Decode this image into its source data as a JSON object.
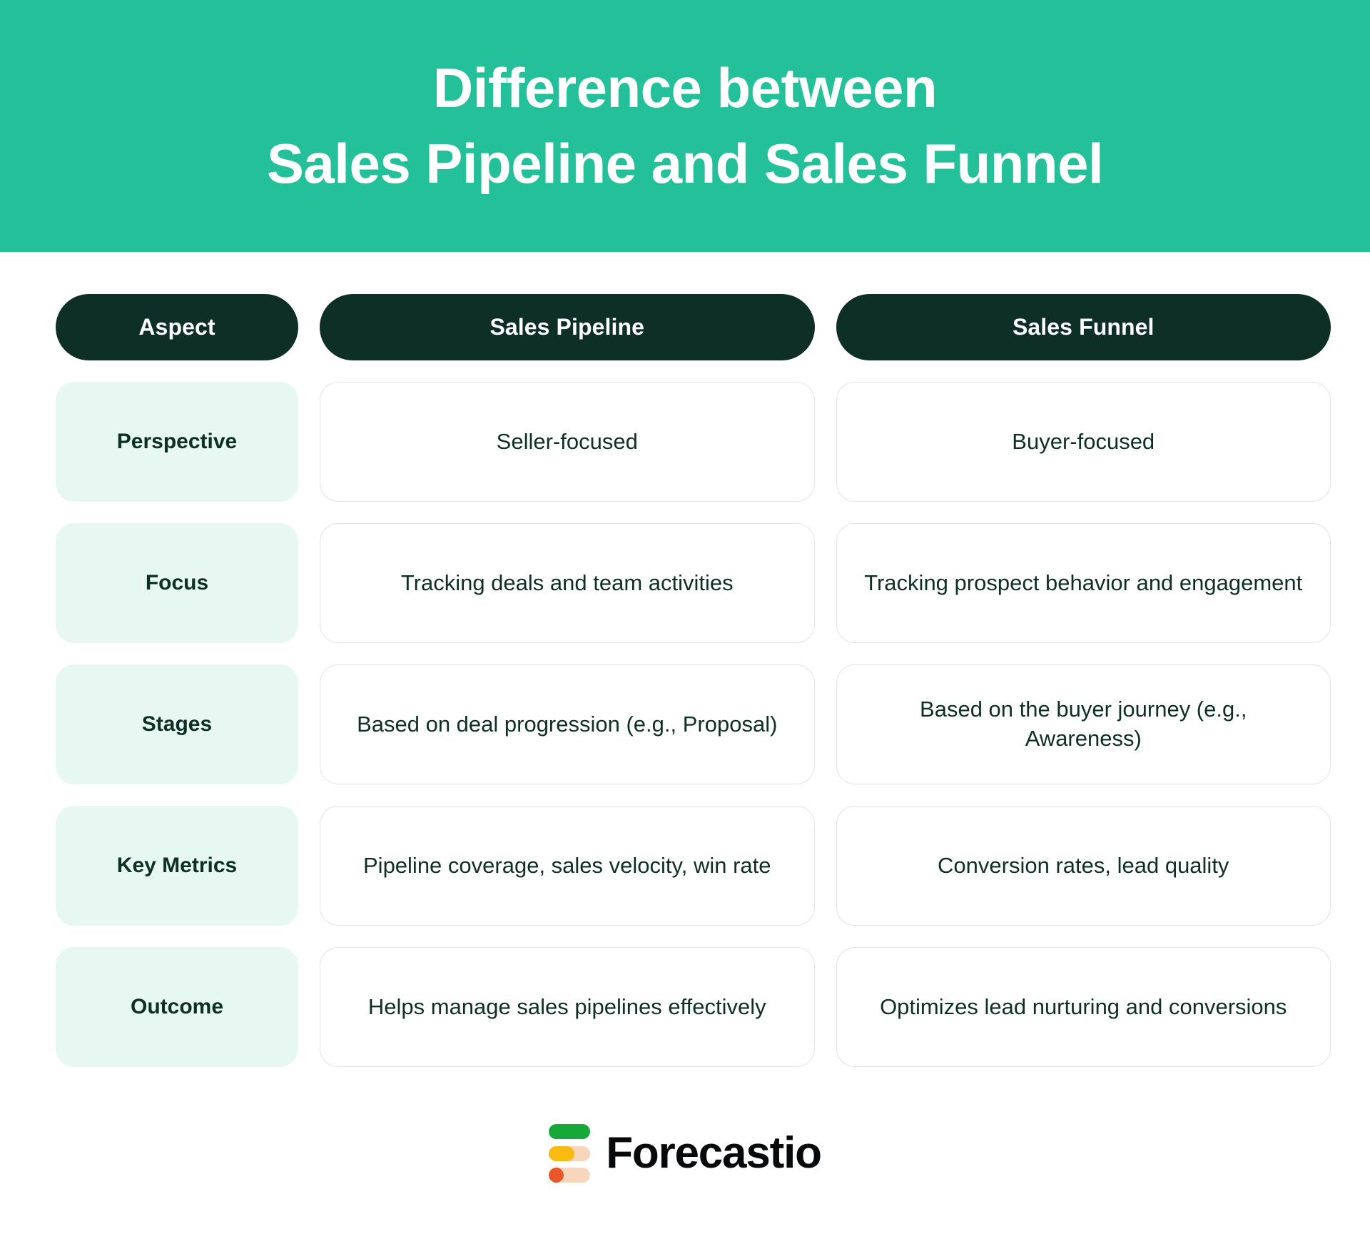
{
  "banner": {
    "title_line1": "Difference between",
    "title_line2": "Sales Pipeline and Sales Funnel",
    "background_color": "#24C09A",
    "text_color": "#FFFFFF"
  },
  "table": {
    "header_background": "#0E2F26",
    "aspect_pill_background": "#E6F8F1",
    "card_border_color": "#E2E5E4",
    "text_color": "#0E2F26",
    "columns": [
      {
        "label": "Aspect"
      },
      {
        "label": "Sales Pipeline"
      },
      {
        "label": "Sales Funnel"
      }
    ],
    "rows": [
      {
        "aspect": "Perspective",
        "pipeline": "Seller-focused",
        "funnel": "Buyer-focused"
      },
      {
        "aspect": "Focus",
        "pipeline": "Tracking deals and team activities",
        "funnel": "Tracking prospect behavior and engagement"
      },
      {
        "aspect": "Stages",
        "pipeline": "Based on deal progression (e.g., Proposal)",
        "funnel": "Based on the buyer journey (e.g., Awareness)"
      },
      {
        "aspect": "Key Metrics",
        "pipeline": "Pipeline coverage, sales velocity, win rate",
        "funnel": "Conversion rates, lead quality"
      },
      {
        "aspect": "Outcome",
        "pipeline": "Helps manage sales pipelines effectively",
        "funnel": "Optimizes lead nurturing and conversions"
      }
    ]
  },
  "footer": {
    "brand_name": "Forecastio",
    "logo_colors": {
      "bar_green": "#16A939",
      "bar_yellow": "#F9BA12",
      "bar_orange": "#E8562A",
      "track_peach": "#F8D6BC"
    }
  }
}
